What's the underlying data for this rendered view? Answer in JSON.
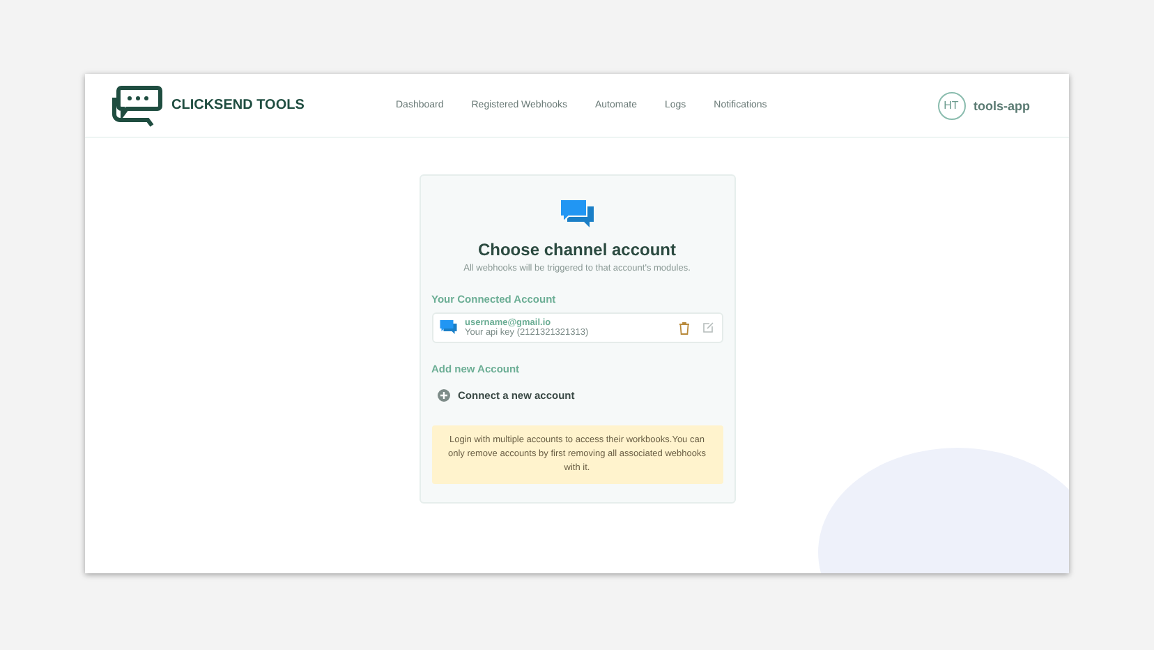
{
  "brand": {
    "name": "CLICKSEND TOOLS"
  },
  "nav": [
    {
      "label": "Dashboard"
    },
    {
      "label": "Registered Webhooks"
    },
    {
      "label": "Automate"
    },
    {
      "label": "Logs"
    },
    {
      "label": "Notifications"
    }
  ],
  "user": {
    "initials": "HT",
    "name": "tools-app"
  },
  "card": {
    "title": "Choose channel account",
    "subtitle": "All webhooks will be triggered to that account's modules.",
    "connected_heading": "Your Connected Account",
    "accounts": [
      {
        "email": "username@gmail.io",
        "api_key": "Your api key (2121321321313)"
      }
    ],
    "add_heading": "Add new Account",
    "connect_label": "Connect a new account",
    "notice": "Login with multiple accounts to access their workbooks.You can only remove accounts by first removing all associated webhooks with it."
  }
}
